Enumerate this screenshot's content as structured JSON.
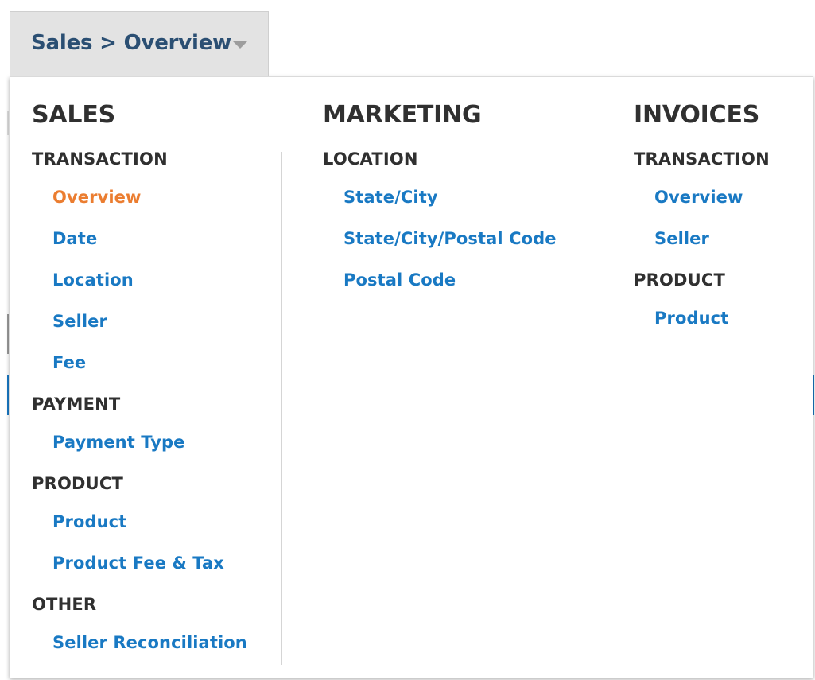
{
  "switcher": {
    "label": "Sales > Overview",
    "icon": "chevron-down-icon"
  },
  "colors": {
    "link": "#1979c3",
    "active_link": "#eb7d30",
    "heading": "#303030",
    "switcher_text": "#2b4f73",
    "switcher_bg": "#e3e3e3"
  },
  "menu": {
    "columns": [
      {
        "heading": "SALES",
        "groups": [
          {
            "title": "TRANSACTION",
            "links": [
              {
                "label": "Overview",
                "active": true
              },
              {
                "label": "Date",
                "active": false
              },
              {
                "label": "Location",
                "active": false
              },
              {
                "label": "Seller",
                "active": false
              },
              {
                "label": "Fee",
                "active": false
              }
            ]
          },
          {
            "title": "PAYMENT",
            "links": [
              {
                "label": "Payment Type",
                "active": false
              }
            ]
          },
          {
            "title": "PRODUCT",
            "links": [
              {
                "label": "Product",
                "active": false
              },
              {
                "label": "Product Fee & Tax",
                "active": false
              }
            ]
          },
          {
            "title": "OTHER",
            "links": [
              {
                "label": "Seller Reconciliation",
                "active": false
              }
            ]
          }
        ]
      },
      {
        "heading": "MARKETING",
        "groups": [
          {
            "title": "LOCATION",
            "links": [
              {
                "label": "State/City",
                "active": false
              },
              {
                "label": "State/City/Postal Code",
                "active": false
              },
              {
                "label": "Postal Code",
                "active": false
              }
            ]
          }
        ]
      },
      {
        "heading": "INVOICES",
        "groups": [
          {
            "title": "TRANSACTION",
            "links": [
              {
                "label": "Overview",
                "active": false
              },
              {
                "label": "Seller",
                "active": false
              }
            ]
          },
          {
            "title": "PRODUCT",
            "links": [
              {
                "label": "Product",
                "active": false
              }
            ]
          }
        ]
      }
    ]
  }
}
